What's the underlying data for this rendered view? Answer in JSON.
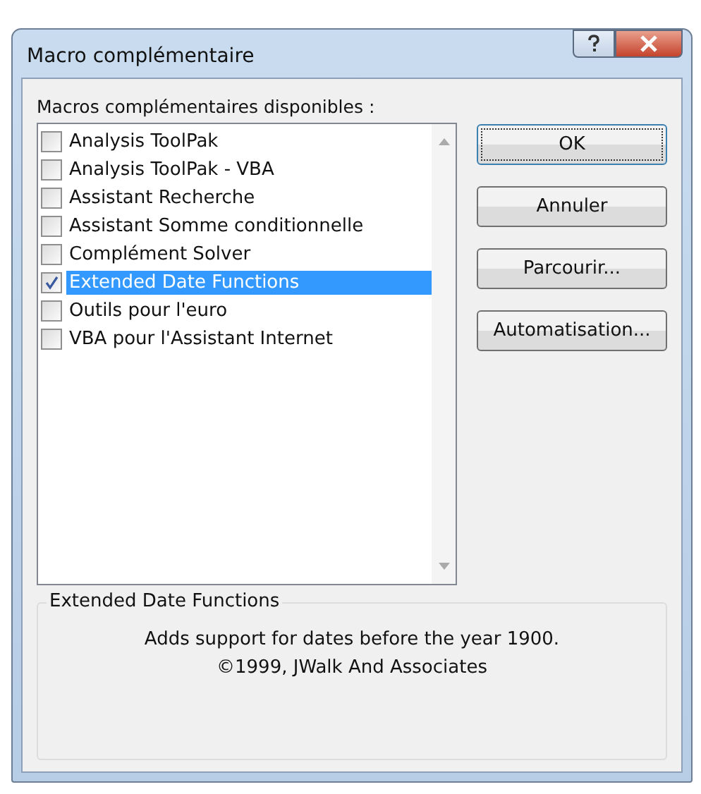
{
  "window": {
    "title": "Macro complémentaire"
  },
  "list_label": "Macros complémentaires disponibles :",
  "addins": [
    {
      "name": "Analysis ToolPak",
      "checked": false,
      "selected": false
    },
    {
      "name": "Analysis ToolPak - VBA",
      "checked": false,
      "selected": false
    },
    {
      "name": "Assistant Recherche",
      "checked": false,
      "selected": false
    },
    {
      "name": "Assistant Somme conditionnelle",
      "checked": false,
      "selected": false
    },
    {
      "name": "Complément Solver",
      "checked": false,
      "selected": false
    },
    {
      "name": "Extended Date Functions",
      "checked": true,
      "selected": true
    },
    {
      "name": "Outils pour l'euro",
      "checked": false,
      "selected": false
    },
    {
      "name": "VBA pour l'Assistant Internet",
      "checked": false,
      "selected": false
    }
  ],
  "buttons": [
    {
      "label": "OK",
      "default": true
    },
    {
      "label": "Annuler",
      "default": false
    },
    {
      "label": "Parcourir...",
      "default": false
    },
    {
      "label": "Automatisation...",
      "default": false
    }
  ],
  "description": {
    "title": "Extended Date Functions",
    "lines": [
      "Adds support for dates before the year 1900.",
      "©1999, JWalk And Associates"
    ]
  }
}
